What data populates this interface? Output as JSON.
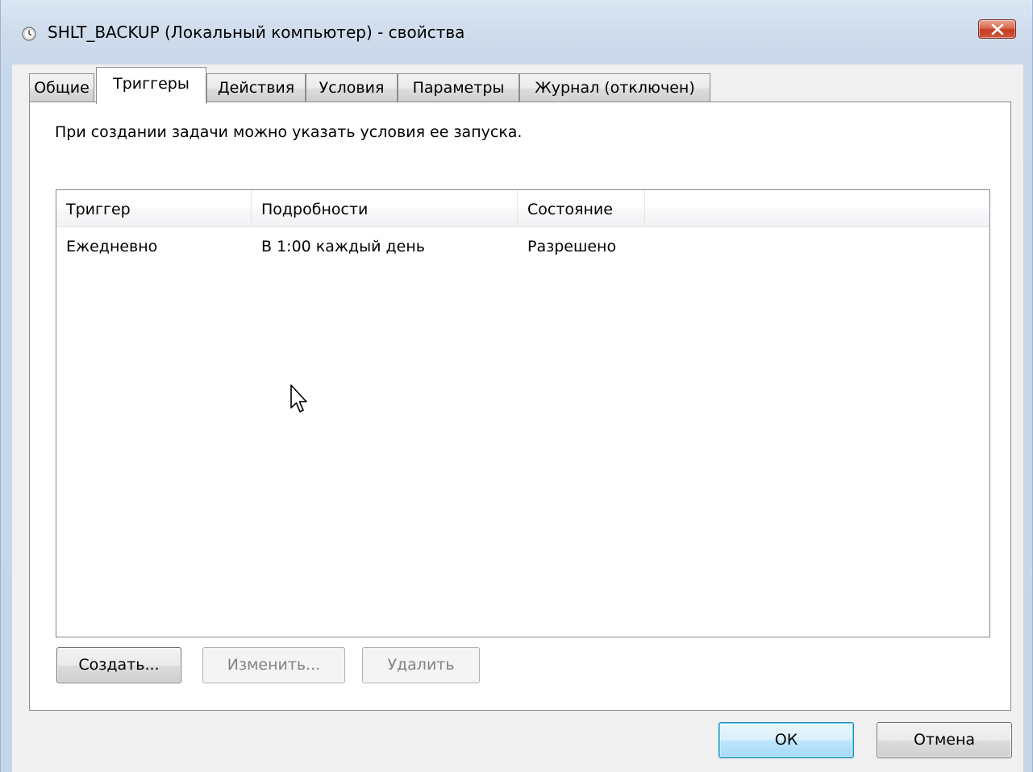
{
  "window": {
    "title": "SHLT_BACKUP (Локальный компьютер) - свойства",
    "icon": "clock-icon",
    "close_icon": "close-icon"
  },
  "tabs": [
    {
      "label": "Общие",
      "active": false
    },
    {
      "label": "Триггеры",
      "active": true
    },
    {
      "label": "Действия",
      "active": false
    },
    {
      "label": "Условия",
      "active": false
    },
    {
      "label": "Параметры",
      "active": false
    },
    {
      "label": "Журнал (отключен)",
      "active": false
    }
  ],
  "triggers_tab": {
    "description": "При создании задачи можно указать условия ее запуска.",
    "columns": [
      "Триггер",
      "Подробности",
      "Состояние"
    ],
    "rows": [
      {
        "trigger": "Ежедневно",
        "details": "В 1:00 каждый день",
        "state": "Разрешено"
      }
    ],
    "buttons": {
      "create": "Создать...",
      "edit": "Изменить...",
      "delete": "Удалить"
    }
  },
  "footer": {
    "ok": "ОК",
    "cancel": "Отмена"
  },
  "colors": {
    "title_bar": "#cfdcec",
    "client_bg": "#f0f0f0",
    "close_button": "#c43c21",
    "default_button_border": "#3c7fb1"
  }
}
